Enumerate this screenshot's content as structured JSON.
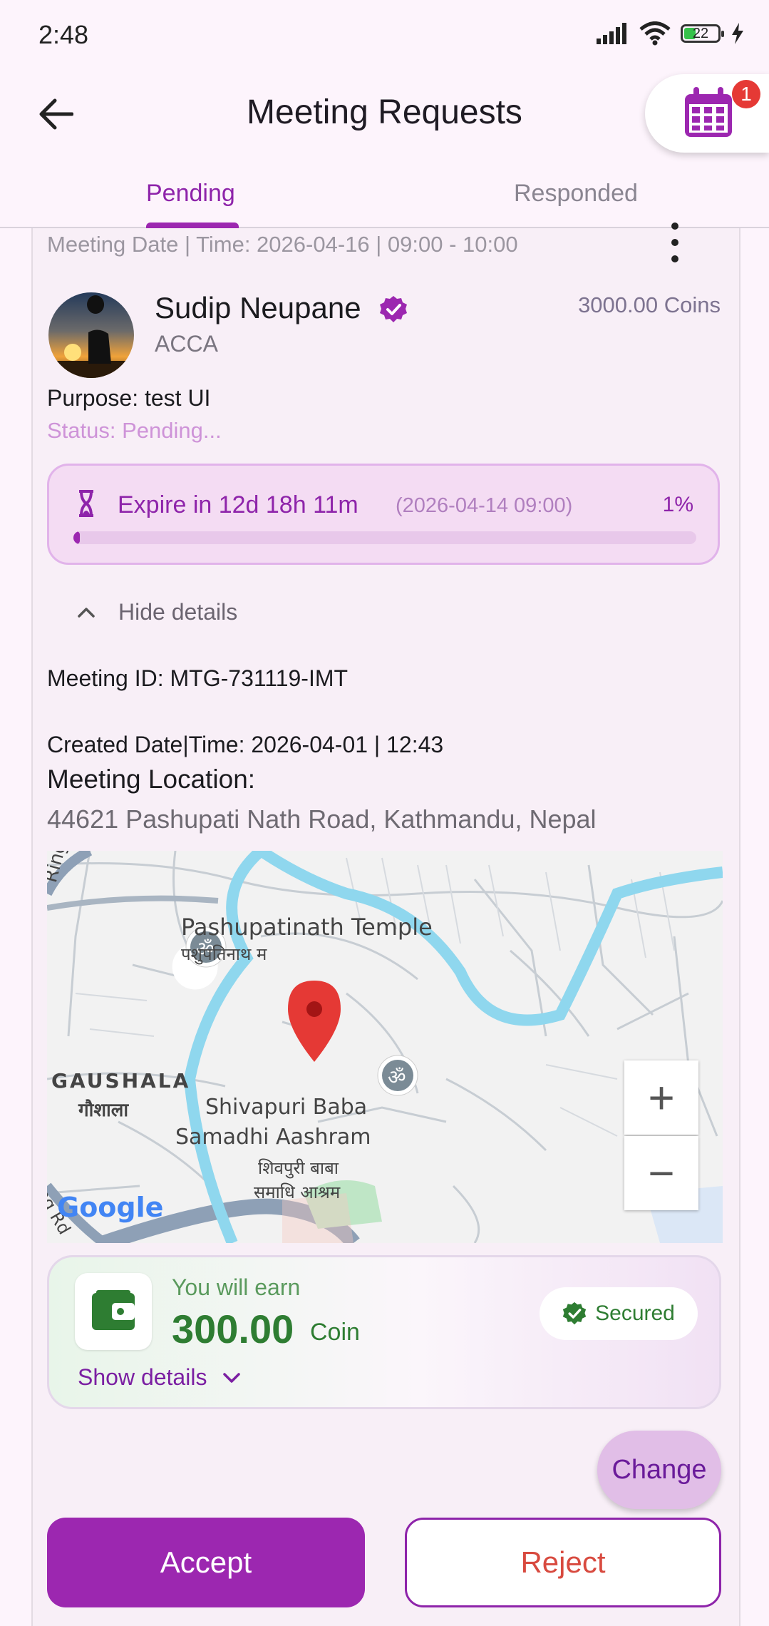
{
  "status_bar": {
    "time": "2:48",
    "battery": "22"
  },
  "app_bar": {
    "title": "Meeting Requests",
    "calendar_badge": "1"
  },
  "tabs": [
    {
      "label": "Pending",
      "active": true
    },
    {
      "label": "Responded",
      "active": false
    }
  ],
  "request": {
    "meeting_date": "Meeting Date | Time: 2026-04-16 | 09:00 - 10:00",
    "name": "Sudip Neupane",
    "profession": "ACCA",
    "coins": "3000.00 Coins",
    "purpose": "Purpose: test UI",
    "status": "Status: Pending...",
    "expire": {
      "label": "Expire in 12d 18h 11m",
      "date": "(2026-04-14 09:00)",
      "percent_label": "1%",
      "progress": 0.01
    },
    "hide_details": "Hide details",
    "meeting_id": "Meeting ID: MTG-731119-IMT",
    "created": "Created Date|Time: 2026-04-01 | 12:43",
    "location_heading": "Meeting Location:",
    "location_address": "44621 Pashupati Nath Road, Kathmandu, Nepal"
  },
  "map": {
    "ring_road": "Ring Rd",
    "temple_en": "Pashupatinath Temple",
    "temple_ne": "पशुपतिनाथ म",
    "gaushala_en": "GAUSHALA",
    "gaushala_ne": "गौशाला",
    "aashram_en_1": "Shivapuri Baba",
    "aashram_en_2": "Samadhi Aashram",
    "aashram_ne_1": "शिवपुरी बाबा",
    "aashram_ne_2": "समाधि आश्रम",
    "ring_road_2": "Ring Rd",
    "google": "Google",
    "zoom_in": "+",
    "zoom_out": "−",
    "om_symbol": "ॐ"
  },
  "earnings": {
    "title": "You will earn",
    "amount": "300.00",
    "unit": "Coin",
    "secured": "Secured",
    "show_details": "Show details"
  },
  "actions": {
    "change": "Change",
    "accept": "Accept",
    "reject": "Reject"
  },
  "colors": {
    "primary": "#9c27b0",
    "reject_text": "#d84a3f",
    "earn_green": "#2e7d32"
  }
}
